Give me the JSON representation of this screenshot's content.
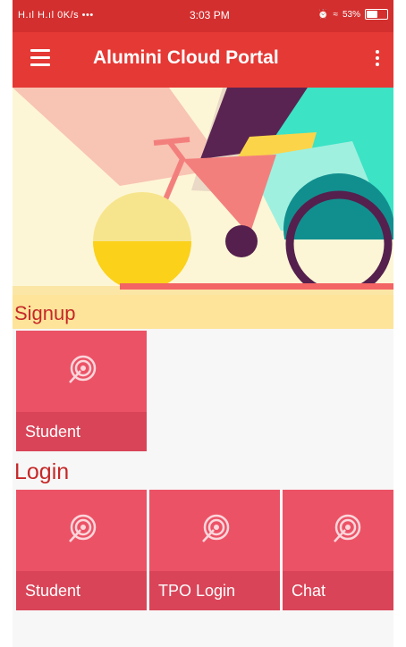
{
  "status_bar": {
    "signal": "H.ıl H.ıl 0K/s •••",
    "time": "3:03 PM",
    "battery": "53%",
    "battery_level": 0.53
  },
  "app_bar": {
    "title": "Alumini Cloud Portal",
    "menu_icon": "hamburger-menu-icon",
    "overflow_icon": "more-vertical-icon"
  },
  "banner": {
    "illustration": "bicycle-illustration"
  },
  "signup": {
    "heading": "Signup",
    "tiles": [
      {
        "label": "Student",
        "icon": "target-icon"
      }
    ]
  },
  "login": {
    "heading": "Login",
    "tiles": [
      {
        "label": "Student",
        "icon": "target-icon"
      },
      {
        "label": "TPO Login",
        "icon": "target-icon"
      },
      {
        "label": "Chat",
        "icon": "target-icon"
      }
    ]
  },
  "colors": {
    "status_bar": "#d32f2f",
    "app_bar": "#e53935",
    "tile": "#ec5266",
    "tile_label_band": "#d94458",
    "heading": "#c62828"
  }
}
